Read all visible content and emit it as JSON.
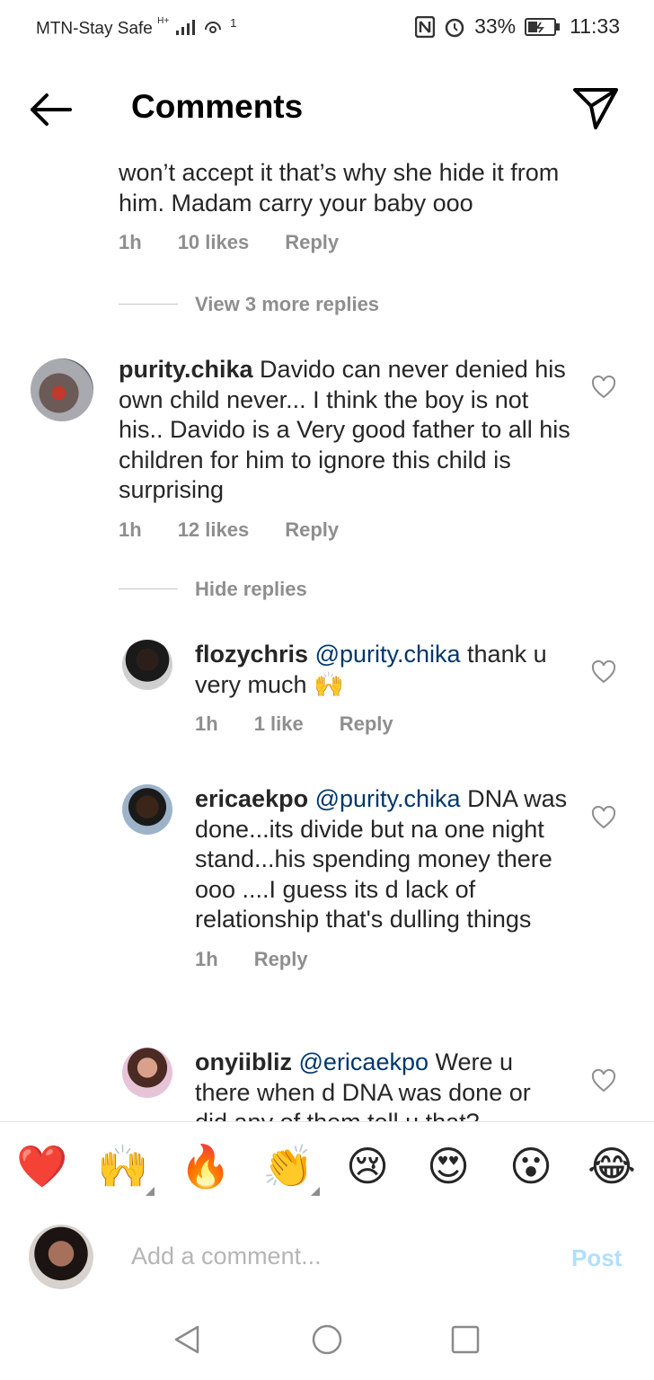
{
  "status_bar": {
    "carrier": "MTN-Stay Safe",
    "network_label": "H+",
    "hotspot_count": "1",
    "battery": "33%",
    "time": "11:33"
  },
  "header": {
    "title": "Comments"
  },
  "comments": [
    {
      "text": "won’t accept it that’s why she hide it from him. Madam carry your baby ooo",
      "time": "1h",
      "likes": "10 likes",
      "reply": "Reply"
    },
    {
      "username": "purity.chika",
      "text": " Davido can never denied his own child never... I think the boy is not his.. Davido is a Very good father to all his children for him to ignore this child is surprising",
      "time": "1h",
      "likes": "12 likes",
      "reply": "Reply"
    }
  ],
  "view_more": "View 3 more replies",
  "hide_replies": "Hide replies",
  "replies": [
    {
      "username": "flozychris",
      "mention": "@purity.chika",
      "text": " thank u very much 🙌",
      "time": "1h",
      "likes": "1 like",
      "reply": "Reply"
    },
    {
      "username": "ericaekpo",
      "mention": "@purity.chika",
      "text": " DNA was done...its divide but na one night stand...his spending money there ooo ....I guess its d lack of relationship that's dulling things",
      "time": "1h",
      "reply": "Reply"
    },
    {
      "username": "onyiibliz",
      "mention": "@ericaekpo",
      "text": " Were u there when d DNA was done or did any of them tell u that?"
    }
  ],
  "emoji_bar": [
    "❤️",
    "🙌",
    "🔥",
    "👏",
    "😢",
    "😍",
    "😮",
    "😂"
  ],
  "composer": {
    "placeholder": "Add a comment...",
    "post": "Post"
  },
  "colors": {
    "accent_post": "#b2dffc",
    "mention": "#00376b",
    "muted": "#8e8e8e"
  }
}
